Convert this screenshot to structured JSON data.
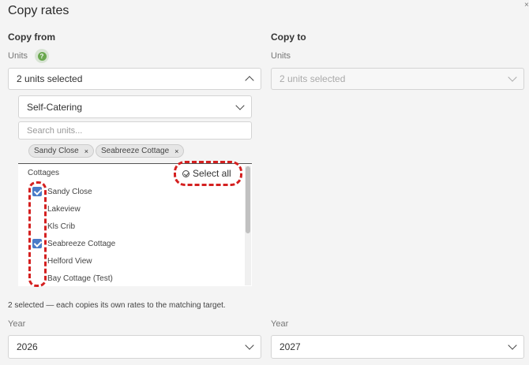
{
  "title": "Copy rates",
  "copy_from": {
    "heading": "Copy from",
    "units_label": "Units",
    "units_value": "2 units selected",
    "category": "Self-Catering",
    "search_placeholder": "Search units...",
    "tags": [
      {
        "label": "Sandy Close"
      },
      {
        "label": "Seabreeze Cottage"
      }
    ],
    "list_header": "Cottages",
    "select_all_label": "Select all",
    "items": [
      {
        "label": "Sandy Close",
        "checked": true
      },
      {
        "label": "Lakeview",
        "checked": false
      },
      {
        "label": "Kls Crib",
        "checked": false
      },
      {
        "label": "Seabreeze Cottage",
        "checked": true
      },
      {
        "label": "Helford View",
        "checked": false
      },
      {
        "label": "Bay Cottage (Test)",
        "checked": false
      }
    ],
    "year_label": "Year",
    "year_value": "2026"
  },
  "copy_to": {
    "heading": "Copy to",
    "units_label": "Units",
    "units_value": "2 units selected",
    "year_label": "Year",
    "year_value": "2027"
  },
  "note": "2 selected — each copies its own rates to the matching target.",
  "icons": {
    "help": "?",
    "remove": "×"
  },
  "colors": {
    "checkbox_checked": "#4a7bc8",
    "highlight_dash": "#d42020",
    "help_icon": "#6aa84f"
  }
}
